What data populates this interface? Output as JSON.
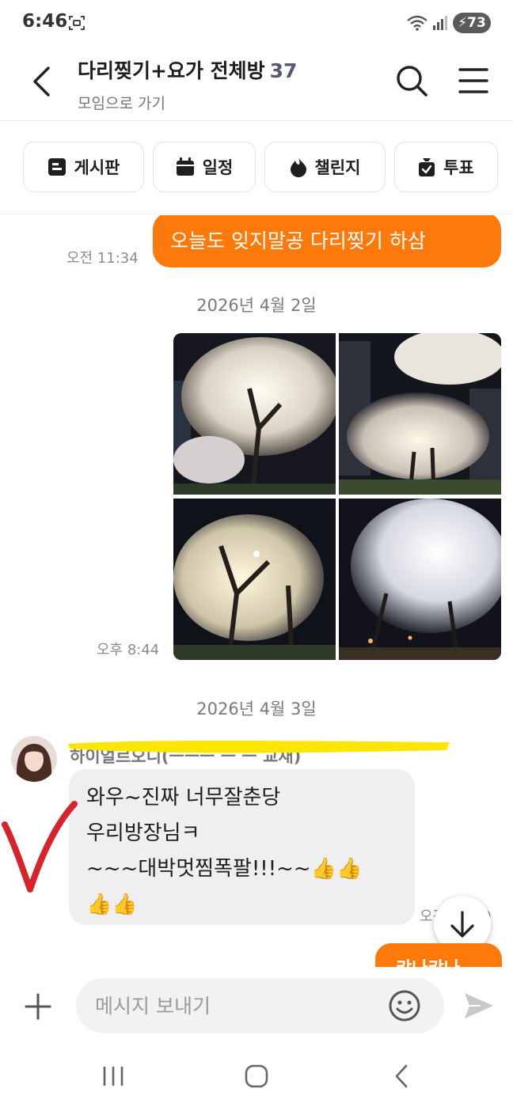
{
  "status_bar": {
    "time": "6:46",
    "battery": "73",
    "icons": [
      "screenshot-icon",
      "wifi-icon",
      "signal-icon",
      "battery-charging-icon"
    ]
  },
  "header": {
    "title": "다리찢기+요가 전체방",
    "member_count": "37",
    "sub_link": "모임으로 가기",
    "icons": [
      "back-arrow-icon",
      "search-icon",
      "hamburger-menu-icon"
    ]
  },
  "quick_menu": [
    {
      "label": "게시판",
      "icon": "board-icon"
    },
    {
      "label": "일정",
      "icon": "calendar-icon"
    },
    {
      "label": "챌린지",
      "icon": "flame-icon"
    },
    {
      "label": "투표",
      "icon": "vote-box-icon"
    }
  ],
  "messages": {
    "first": {
      "text": "오늘도 잊지말공 다리찢기 하삼",
      "time": "오전 11:34"
    },
    "date_sep_1": "2026년 4월 2일",
    "photo_time": "오후 8:44",
    "date_sep_2": "2026년 4월 3일",
    "reply": {
      "lines": [
        "와우~진짜 너무잘춘당",
        "우리방장님ㅋ",
        "~~~대박멋찜폭팔!!!~~👍👍",
        "👍👍"
      ],
      "time": "오전 12:39"
    },
    "peek_text": "캬나캬나"
  },
  "input": {
    "placeholder": "메시지 보내기"
  },
  "colors": {
    "accent": "#ff7a0a",
    "bubble_gray": "#efeff1",
    "highlight": "#ffe600",
    "check_mark": "#d8232a"
  }
}
